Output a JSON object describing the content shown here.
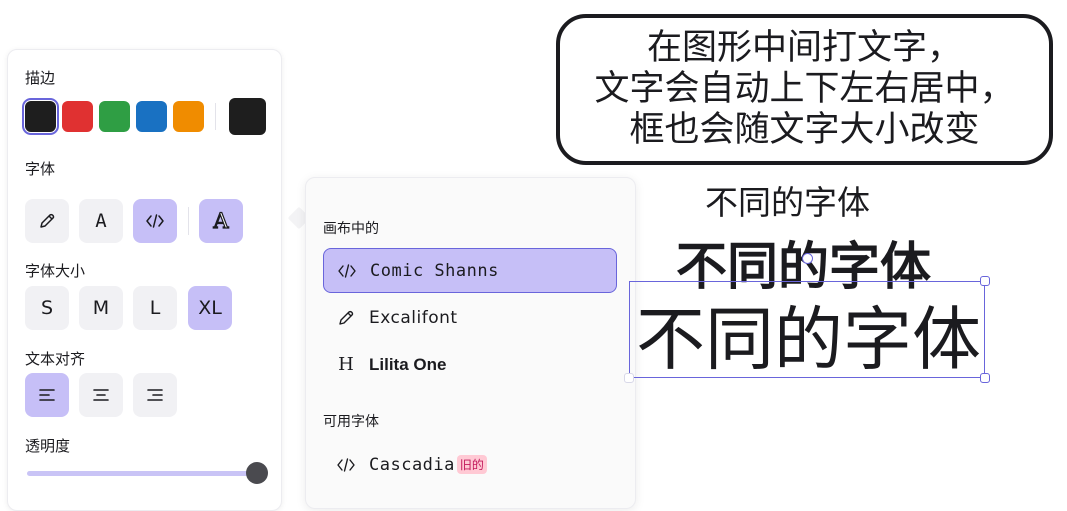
{
  "panel": {
    "stroke_label": "描边",
    "stroke_colors": [
      {
        "name": "black",
        "hex": "#1e1e1e",
        "selected": true
      },
      {
        "name": "red",
        "hex": "#e03131",
        "selected": false
      },
      {
        "name": "green",
        "hex": "#2f9e44",
        "selected": false
      },
      {
        "name": "blue",
        "hex": "#1971c2",
        "selected": false
      },
      {
        "name": "orange",
        "hex": "#f08c00",
        "selected": false
      }
    ],
    "current_color": "#1e1e1e",
    "font_label": "字体",
    "font_buttons": [
      {
        "icon": "pencil-icon",
        "active": false
      },
      {
        "icon": "font-a-icon",
        "text": "A",
        "active": false
      },
      {
        "icon": "code-icon",
        "active": true
      },
      {
        "icon": "font-picker-icon",
        "text": "A",
        "active": true
      }
    ],
    "font_size_label": "字体大小",
    "font_sizes": [
      {
        "label": "S",
        "active": false
      },
      {
        "label": "M",
        "active": false
      },
      {
        "label": "L",
        "active": false
      },
      {
        "label": "XL",
        "active": true
      }
    ],
    "text_align_label": "文本对齐",
    "text_align": [
      {
        "icon": "align-left-icon",
        "active": true
      },
      {
        "icon": "align-center-icon",
        "active": false
      },
      {
        "icon": "align-right-icon",
        "active": false
      }
    ],
    "opacity_label": "透明度",
    "opacity_value": 1.0
  },
  "font_popover": {
    "in_scene_heading": "画布中的",
    "in_scene_fonts": [
      {
        "icon": "code-icon",
        "label": "Comic Shanns",
        "selected": true
      },
      {
        "icon": "pencil-icon",
        "label": "Excalifont",
        "selected": false
      },
      {
        "icon": "heading-h-icon",
        "label": "Lilita One",
        "selected": false
      }
    ],
    "available_heading": "可用字体",
    "available_fonts": [
      {
        "icon": "code-icon",
        "label": "Cascadia",
        "badge": "旧的"
      }
    ]
  },
  "canvas": {
    "bubble_lines": [
      "在图形中间打文字，",
      "文字会自动上下左右居中，",
      "框也会随文字大小改变"
    ],
    "text_small": "不同的字体",
    "text_medium": "不同的字体",
    "text_large": "不同的字体",
    "selection_color": "#6965db",
    "accent_color": "#c6bff7"
  }
}
